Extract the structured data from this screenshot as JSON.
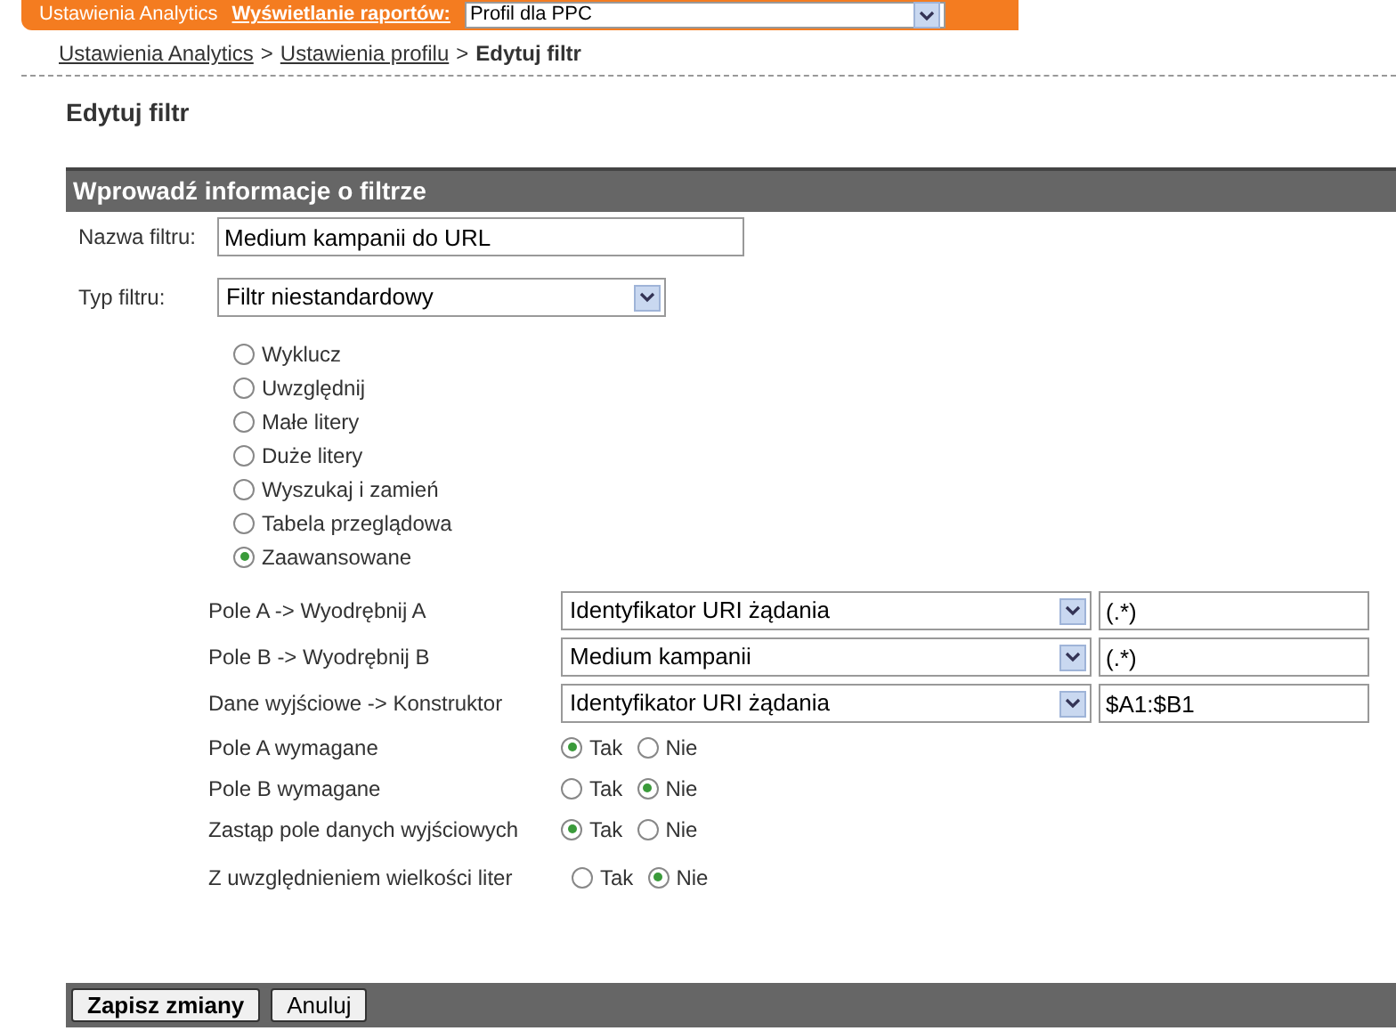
{
  "top_bar": {
    "items": [
      {
        "kind": "text",
        "label": "Ustawienia Analytics"
      },
      {
        "kind": "link",
        "label": "Wyświetlanie raportów:"
      },
      {
        "kind": "select",
        "label": "Profil dla PPC"
      }
    ]
  },
  "breadcrumb": [
    {
      "label": "Ustawienia Analytics",
      "current": false
    },
    {
      "label": "Ustawienia profilu",
      "current": false
    },
    {
      "label": "Edytuj filtr",
      "current": true
    }
  ],
  "breadcrumb_separator": ">",
  "page_title": "Edytuj filtr",
  "section_title": "Wprowadź informacje o filtrze",
  "filter_name": {
    "label": "Nazwa filtru:",
    "value": "Medium kampanii do URL"
  },
  "filter_type": {
    "label": "Typ filtru:",
    "value": "Filtr niestandardowy"
  },
  "filter_options": [
    {
      "label": "Wyklucz",
      "selected": false
    },
    {
      "label": "Uwzględnij",
      "selected": false
    },
    {
      "label": "Małe litery",
      "selected": false
    },
    {
      "label": "Duże litery",
      "selected": false
    },
    {
      "label": "Wyszukaj i zamień",
      "selected": false
    },
    {
      "label": "Tabela przeglądowa",
      "selected": false
    },
    {
      "label": "Zaawansowane",
      "selected": true
    }
  ],
  "field_rows": [
    {
      "label": "Pole A -> Wyodrębnij A",
      "select": "Identyfikator URI żądania",
      "value": "(.*)"
    },
    {
      "label": "Pole B -> Wyodrębnij B",
      "select": "Medium kampanii",
      "value": "(.*)"
    },
    {
      "label": "Dane wyjściowe -> Konstruktor",
      "select": "Identyfikator URI żądania",
      "value": "$A1:$B1"
    }
  ],
  "yes_no_rows": [
    {
      "label": "Pole A wymagane",
      "options": [
        {
          "label": "Tak",
          "selected": true
        },
        {
          "label": "Nie",
          "selected": false
        }
      ]
    },
    {
      "label": "Pole B wymagane",
      "options": [
        {
          "label": "Tak",
          "selected": false
        },
        {
          "label": "Nie",
          "selected": true
        }
      ]
    },
    {
      "label": "Zastąp pole danych wyjściowych",
      "options": [
        {
          "label": "Tak",
          "selected": true
        },
        {
          "label": "Nie",
          "selected": false
        }
      ]
    },
    {
      "label": "Z uwzględnieniem wielkości liter",
      "options": [
        {
          "label": "Tak",
          "selected": false
        },
        {
          "label": "Nie",
          "selected": true
        }
      ]
    }
  ],
  "buttons": [
    {
      "label": "Zapisz zmiany",
      "kind": "primary"
    },
    {
      "label": "Anuluj",
      "kind": "secondary"
    }
  ]
}
